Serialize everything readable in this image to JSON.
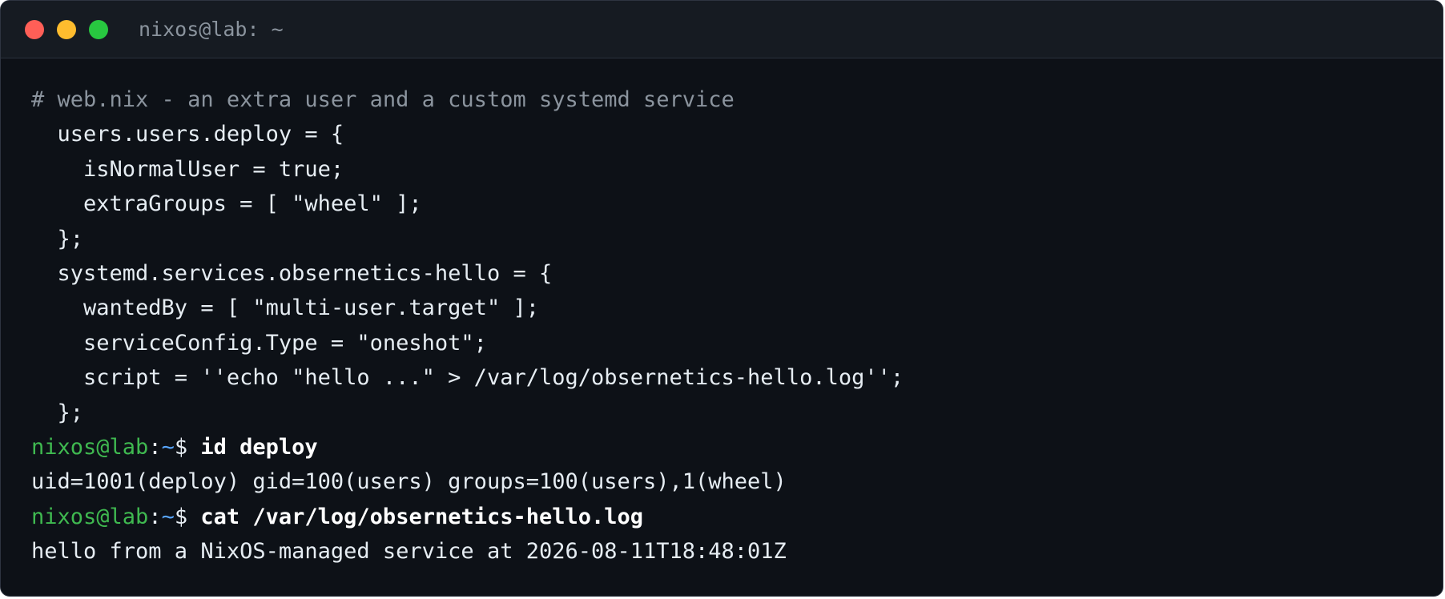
{
  "window": {
    "title": "nixos@lab: ~"
  },
  "colors": {
    "background": "#0d1117",
    "titlebar": "#161b22",
    "prompt_user": "#3fb950",
    "prompt_path": "#58a6ff",
    "comment": "#8b949e",
    "text": "#e6edf3"
  },
  "code": [
    "# web.nix - an extra user and a custom systemd service",
    "  users.users.deploy = {",
    "    isNormalUser = true;",
    "    extraGroups = [ \"wheel\" ];",
    "  };",
    "  systemd.services.obsernetics-hello = {",
    "    wantedBy = [ \"multi-user.target\" ];",
    "    serviceConfig.Type = \"oneshot\";",
    "    script = ''echo \"hello ...\" > /var/log/obsernetics-hello.log'';",
    "  };"
  ],
  "prompt": {
    "user_host": "nixos@lab",
    "colon": ":",
    "path": "~",
    "dollar": "$ "
  },
  "session": [
    {
      "command": "id deploy",
      "output": "uid=1001(deploy) gid=100(users) groups=100(users),1(wheel)"
    },
    {
      "command": "cat /var/log/obsernetics-hello.log",
      "output": "hello from a NixOS-managed service at 2026-08-11T18:48:01Z"
    }
  ]
}
